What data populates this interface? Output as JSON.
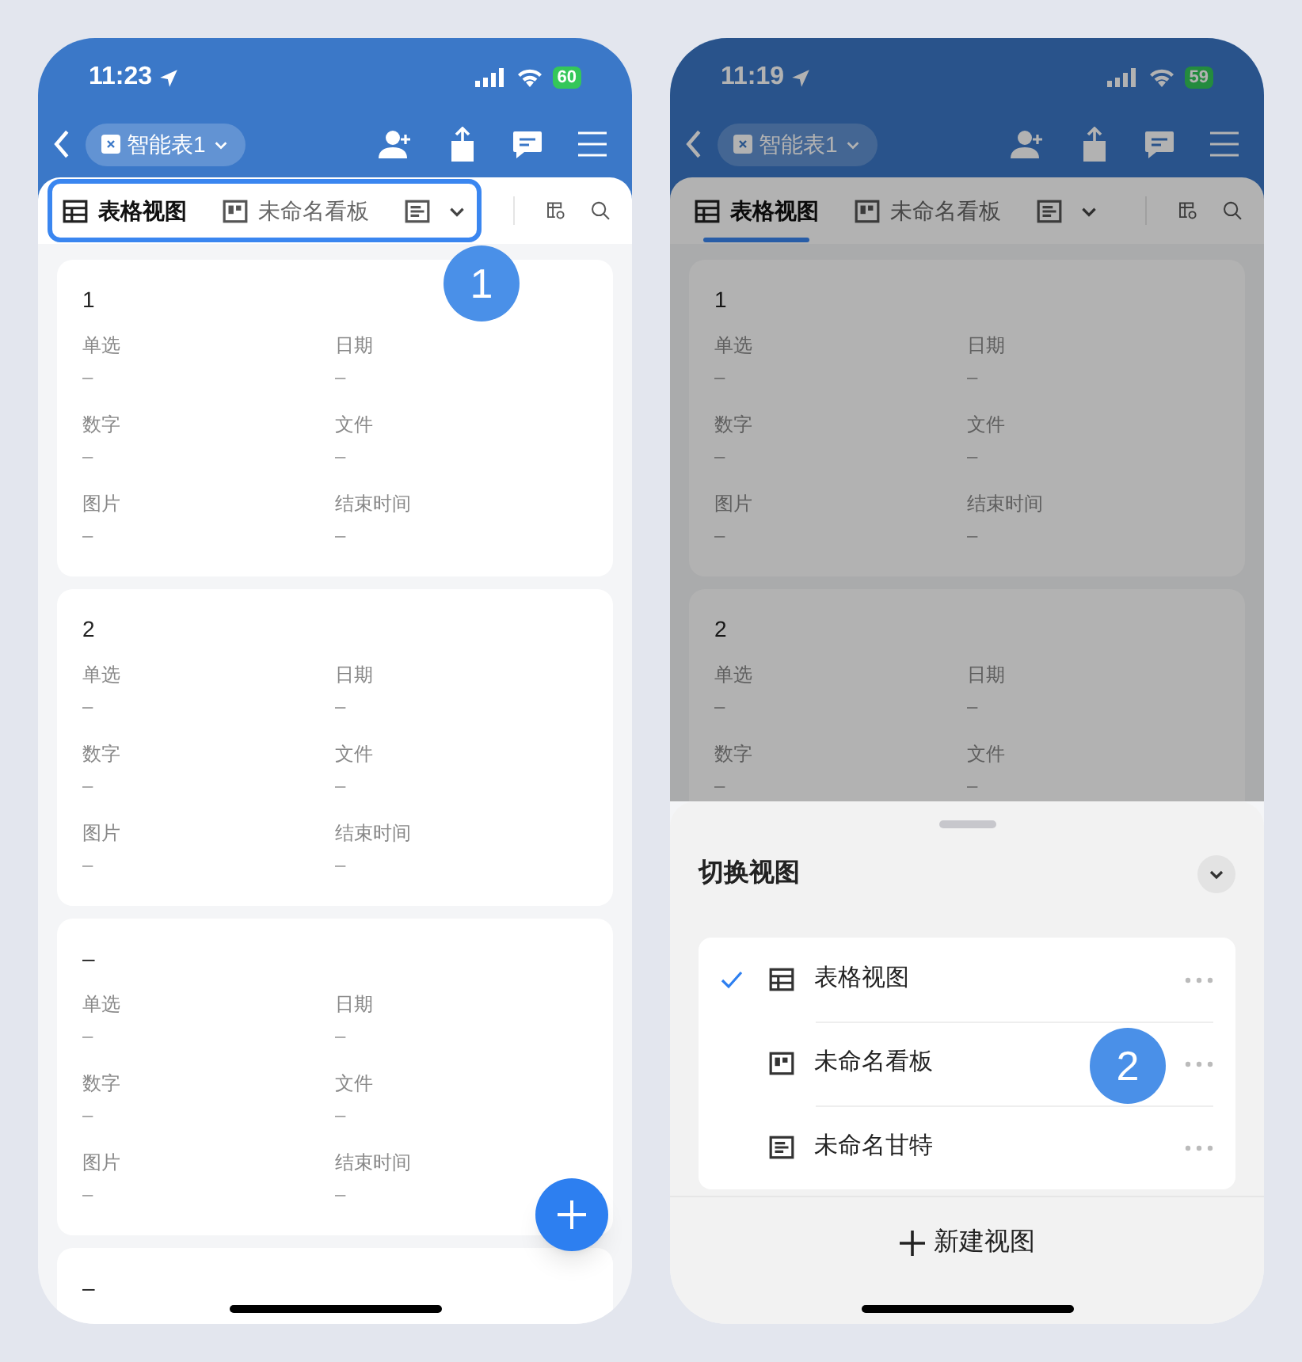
{
  "phones": [
    {
      "status": {
        "time": "11:23",
        "battery": "60"
      },
      "doc_title": "智能表1",
      "tabs_highlighted": true,
      "tabs_annotation": "1",
      "fab": true,
      "tabs": [
        {
          "label": "表格视图",
          "kind": "grid",
          "selected": true
        },
        {
          "label": "未命名看板",
          "kind": "board",
          "selected": false
        },
        {
          "kind": "gantt",
          "selected": false
        }
      ],
      "cards": [
        {
          "title": "1",
          "fields": [
            {
              "label": "单选",
              "value": "–"
            },
            {
              "label": "日期",
              "value": "–"
            },
            {
              "label": "数字",
              "value": "–"
            },
            {
              "label": "文件",
              "value": "–"
            },
            {
              "label": "图片",
              "value": "–"
            },
            {
              "label": "结束时间",
              "value": "–"
            }
          ]
        },
        {
          "title": "2",
          "fields": [
            {
              "label": "单选",
              "value": "–"
            },
            {
              "label": "日期",
              "value": "–"
            },
            {
              "label": "数字",
              "value": "–"
            },
            {
              "label": "文件",
              "value": "–"
            },
            {
              "label": "图片",
              "value": "–"
            },
            {
              "label": "结束时间",
              "value": "–"
            }
          ]
        },
        {
          "title": "–",
          "fields": [
            {
              "label": "单选",
              "value": "–"
            },
            {
              "label": "日期",
              "value": "–"
            },
            {
              "label": "数字",
              "value": "–"
            },
            {
              "label": "文件",
              "value": "–"
            },
            {
              "label": "图片",
              "value": "–"
            },
            {
              "label": "结束时间",
              "value": "–"
            }
          ]
        },
        {
          "title": "–"
        }
      ]
    },
    {
      "status": {
        "time": "11:19",
        "battery": "59"
      },
      "doc_title": "智能表1",
      "tabs_highlighted": false,
      "fab": false,
      "tabs": [
        {
          "label": "表格视图",
          "kind": "grid",
          "selected": true
        },
        {
          "label": "未命名看板",
          "kind": "board",
          "selected": false
        },
        {
          "kind": "gantt",
          "selected": false
        }
      ],
      "cards": [
        {
          "title": "1",
          "fields": [
            {
              "label": "单选",
              "value": "–"
            },
            {
              "label": "日期",
              "value": "–"
            },
            {
              "label": "数字",
              "value": "–"
            },
            {
              "label": "文件",
              "value": "–"
            },
            {
              "label": "图片",
              "value": "–"
            },
            {
              "label": "结束时间",
              "value": "–"
            }
          ]
        },
        {
          "title": "2",
          "fields": [
            {
              "label": "单选",
              "value": "–"
            },
            {
              "label": "日期",
              "value": "–"
            },
            {
              "label": "数字",
              "value": "–"
            },
            {
              "label": "文件",
              "value": "–"
            }
          ]
        }
      ],
      "sheet": {
        "title": "切换视图",
        "items": [
          {
            "label": "表格视图",
            "kind": "grid",
            "selected": true
          },
          {
            "label": "未命名看板",
            "kind": "board",
            "selected": false,
            "annotation": "2"
          },
          {
            "label": "未命名甘特",
            "kind": "gantt",
            "selected": false
          }
        ],
        "new_button": "新建视图"
      }
    }
  ]
}
